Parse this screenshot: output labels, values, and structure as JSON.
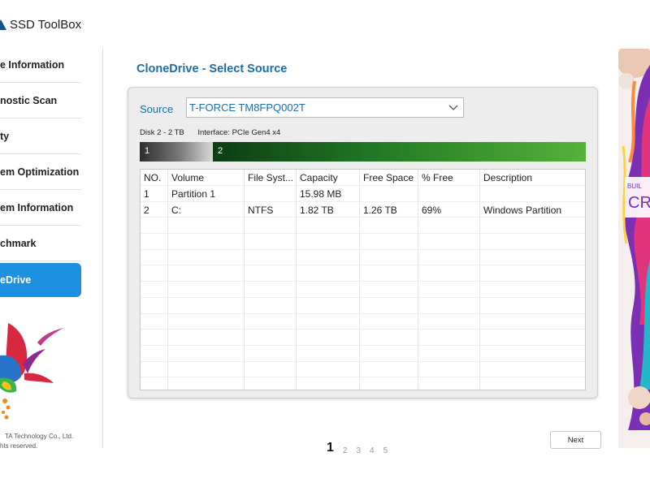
{
  "app": {
    "title": "SSD ToolBox",
    "copyright_line1": "TA Technology Co., Ltd.",
    "copyright_line2": "hts reserved."
  },
  "sidebar": {
    "items": [
      {
        "label": "e Information",
        "active": false
      },
      {
        "label": "nostic Scan",
        "active": false
      },
      {
        "label": "ty",
        "active": false
      },
      {
        "label": "em Optimization",
        "active": false
      },
      {
        "label": "em Information",
        "active": false
      },
      {
        "label": "chmark",
        "active": false
      },
      {
        "label": "eDrive",
        "active": true
      }
    ]
  },
  "main": {
    "title": "CloneDrive - Select Source",
    "source_label": "Source",
    "source_value": "T-FORCE TM8FPQ002T",
    "disk_label": "Disk 2 - 2 TB",
    "interface_label": "Interface: PCIe Gen4 x4",
    "partition_bar": {
      "seg1_label": "1",
      "seg2_label": "2"
    },
    "table": {
      "headers": [
        "NO.",
        "Volume",
        "File Syst...",
        "Capacity",
        "Free Space",
        "% Free",
        "Description"
      ],
      "rows": [
        [
          "1",
          "Partition 1",
          "",
          "15.98 MB",
          "",
          "",
          ""
        ],
        [
          "2",
          "C:",
          "NTFS",
          "1.82 TB",
          "1.26 TB",
          "69%",
          "Windows Partition"
        ]
      ]
    }
  },
  "pagination": {
    "pages": [
      "1",
      "2",
      "3",
      "4",
      "5"
    ],
    "current": "1"
  },
  "next_label": "Next",
  "ad": {
    "text_1": "BUIL",
    "text_2": "CR"
  },
  "colors": {
    "accent": "#1e90e0",
    "title_blue": "#1b6ea8",
    "partition_green": "#237a25"
  }
}
